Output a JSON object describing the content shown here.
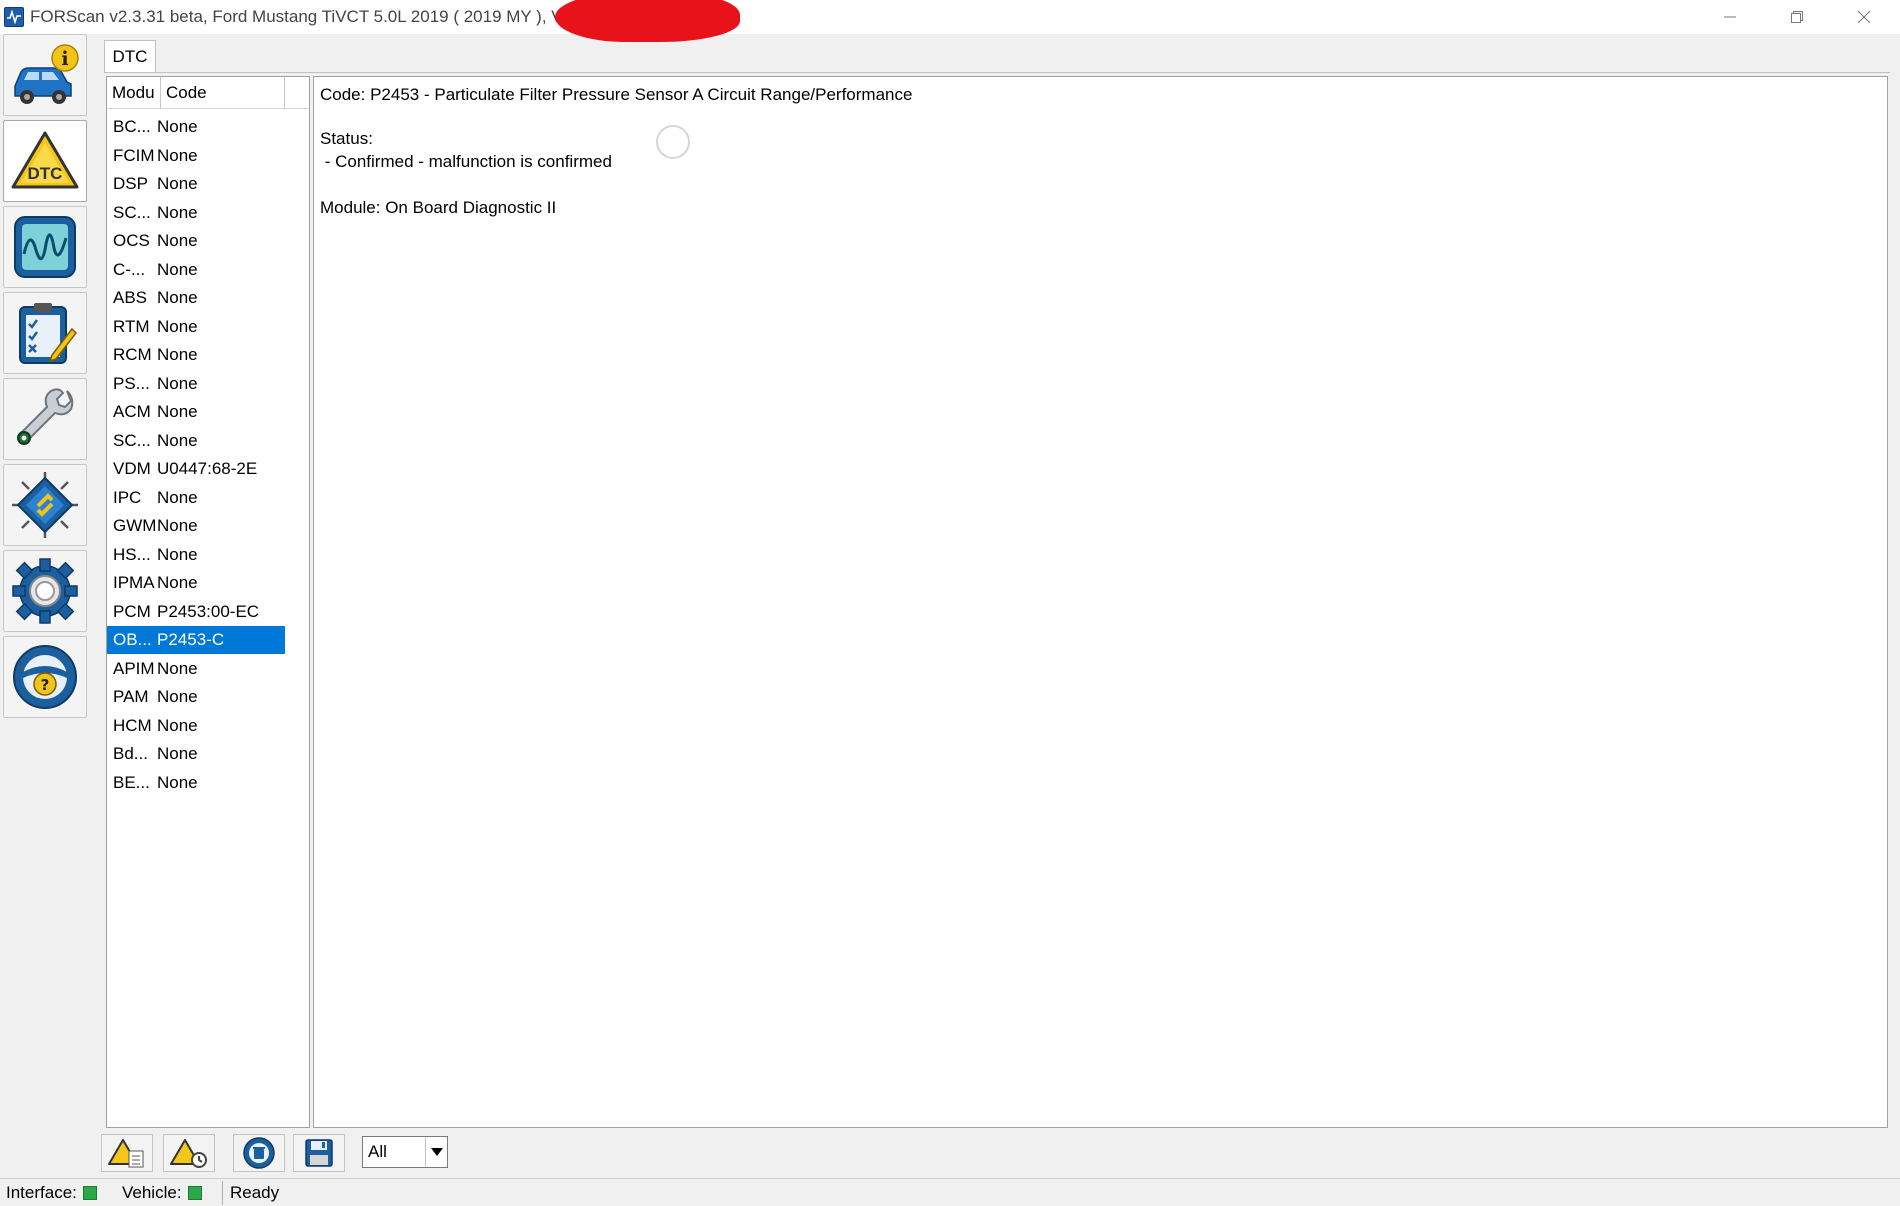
{
  "window": {
    "title": "FORScan v2.3.31 beta, Ford Mustang TiVCT 5.0L 2019 ( 2019 MY ), VIN",
    "controls": {
      "minimize": "minimize-icon",
      "restore": "restore-icon",
      "close": "close-icon"
    }
  },
  "sidebar": {
    "items": [
      {
        "name": "vehicle-info",
        "icon": "car-info-icon"
      },
      {
        "name": "dtc",
        "icon": "dtc-warning-icon",
        "label": "DTC",
        "active": true
      },
      {
        "name": "oscilloscope",
        "icon": "oscilloscope-icon"
      },
      {
        "name": "tests",
        "icon": "checklist-icon"
      },
      {
        "name": "service",
        "icon": "wrench-icon"
      },
      {
        "name": "configuration",
        "icon": "chip-icon"
      },
      {
        "name": "settings",
        "icon": "gear-icon"
      },
      {
        "name": "help",
        "icon": "help-icon"
      }
    ]
  },
  "tabs": [
    {
      "label": "DTC",
      "active": true
    }
  ],
  "dtc_table": {
    "columns": [
      "Modu",
      "Code"
    ],
    "rows": [
      {
        "module": "BC...",
        "code": "None"
      },
      {
        "module": "FCIM",
        "code": "None"
      },
      {
        "module": "DSP",
        "code": "None"
      },
      {
        "module": "SC...",
        "code": "None"
      },
      {
        "module": "OCS",
        "code": "None"
      },
      {
        "module": "C-...",
        "code": "None"
      },
      {
        "module": "ABS",
        "code": "None"
      },
      {
        "module": "RTM",
        "code": "None"
      },
      {
        "module": "RCM",
        "code": "None"
      },
      {
        "module": "PS...",
        "code": "None"
      },
      {
        "module": "ACM",
        "code": "None"
      },
      {
        "module": "SC...",
        "code": "None"
      },
      {
        "module": "VDM",
        "code": "U0447:68-2E"
      },
      {
        "module": "IPC",
        "code": "None"
      },
      {
        "module": "GWM",
        "code": "None"
      },
      {
        "module": "HS...",
        "code": "None"
      },
      {
        "module": "IPMA",
        "code": "None"
      },
      {
        "module": "PCM",
        "code": "P2453:00-EC"
      },
      {
        "module": "OB...",
        "code": "P2453-C",
        "selected": true
      },
      {
        "module": "APIM",
        "code": "None"
      },
      {
        "module": "PAM",
        "code": "None"
      },
      {
        "module": "HCM",
        "code": "None"
      },
      {
        "module": "Bd...",
        "code": "None"
      },
      {
        "module": "BE...",
        "code": "None"
      }
    ]
  },
  "details": {
    "code_line": "Code: P2453 - Particulate Filter Pressure Sensor A Circuit Range/Performance",
    "status_label": "Status:",
    "status_value": " - Confirmed - malfunction is confirmed",
    "module_line": "Module: On Board Diagnostic II"
  },
  "toolbar": {
    "buttons": [
      {
        "name": "read-dtc",
        "icon": "warning-list-icon"
      },
      {
        "name": "read-dtc-refresh",
        "icon": "warning-refresh-icon"
      },
      {
        "name": "clear-dtc",
        "icon": "clear-icon"
      },
      {
        "name": "save",
        "icon": "save-icon"
      }
    ],
    "filter": {
      "value": "All"
    }
  },
  "statusbar": {
    "interface_label": "Interface:",
    "vehicle_label": "Vehicle:",
    "state": "Ready",
    "interface_color": "#2aa84a",
    "vehicle_color": "#2aa84a"
  },
  "colors": {
    "selection": "#0078d7",
    "redaction": "#e8121a"
  }
}
